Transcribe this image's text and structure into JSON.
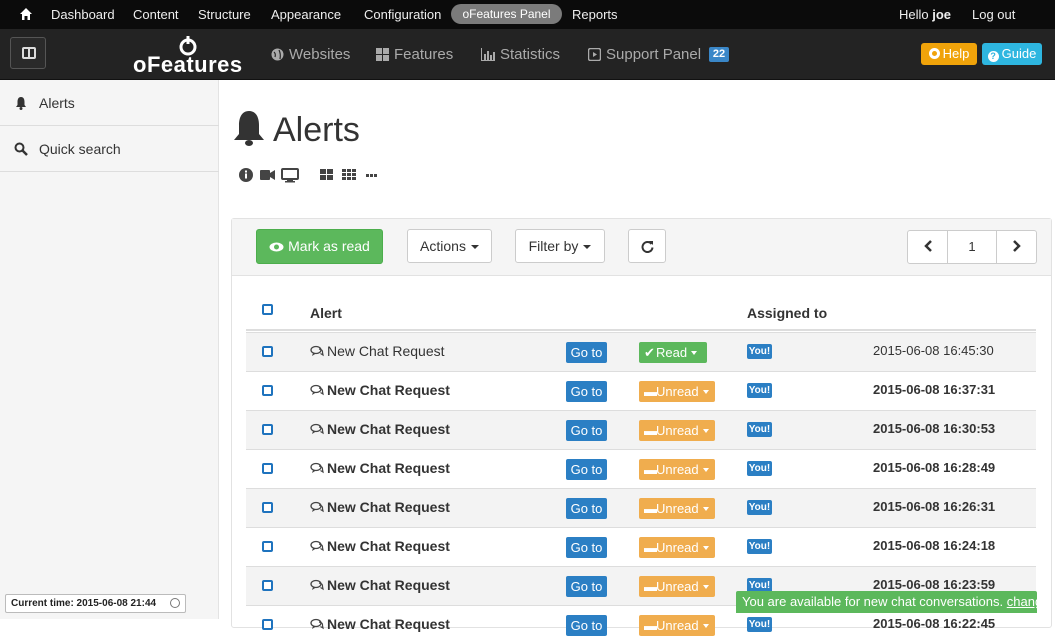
{
  "admin_menu": {
    "items": [
      "Dashboard",
      "Content",
      "Structure",
      "Appearance",
      "Configuration"
    ],
    "active": "oFeatures Panel",
    "reports": "Reports",
    "hello": "Hello",
    "username": "joe",
    "logout": "Log out"
  },
  "navbar": {
    "brand": "oFeatures",
    "links": [
      "Websites",
      "Features",
      "Statistics",
      "Support Panel"
    ],
    "support_badge": "22",
    "help": "Help",
    "guide": "Guide"
  },
  "sidebar": {
    "items": [
      {
        "label": "Alerts",
        "icon": "bell-icon"
      },
      {
        "label": "Quick search",
        "icon": "search-icon"
      }
    ],
    "current_time": "Current time: 2015-06-08 21:44"
  },
  "page": {
    "title": "Alerts"
  },
  "toolbar": {
    "mark_read": "Mark as read",
    "actions": "Actions",
    "filter_by": "Filter by",
    "page_number": "1"
  },
  "table": {
    "headers": {
      "alert": "Alert",
      "assigned": "Assigned to"
    },
    "goto_label": "Go to",
    "assigned_label": "You!",
    "rows": [
      {
        "title": "New Chat Request",
        "status": "Read",
        "time": "2015-06-08 16:45:30",
        "unread": false
      },
      {
        "title": "New Chat Request",
        "status": "Unread",
        "time": "2015-06-08 16:37:31",
        "unread": true
      },
      {
        "title": "New Chat Request",
        "status": "Unread",
        "time": "2015-06-08 16:30:53",
        "unread": true
      },
      {
        "title": "New Chat Request",
        "status": "Unread",
        "time": "2015-06-08 16:28:49",
        "unread": true
      },
      {
        "title": "New Chat Request",
        "status": "Unread",
        "time": "2015-06-08 16:26:31",
        "unread": true
      },
      {
        "title": "New Chat Request",
        "status": "Unread",
        "time": "2015-06-08 16:24:18",
        "unread": true
      },
      {
        "title": "New Chat Request",
        "status": "Unread",
        "time": "2015-06-08 16:23:59",
        "unread": true
      },
      {
        "title": "New Chat Request",
        "status": "Unread",
        "time": "2015-06-08 16:22:45",
        "unread": true
      }
    ]
  },
  "availability": {
    "text": "You are available for new chat conversations.",
    "link": "change"
  },
  "colors": {
    "read": "#5cb85c",
    "unread": "#f0ad4e",
    "primary": "#2b7fc4",
    "help": "#f0a30a",
    "guide": "#2eb6e0"
  }
}
